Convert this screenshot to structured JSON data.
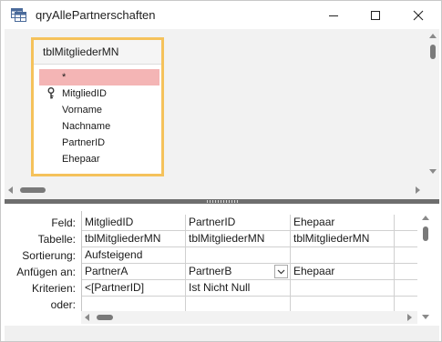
{
  "window": {
    "title": "qryAllePartnerschaften"
  },
  "table": {
    "name": "tblMitgliederMN",
    "fields": [
      "*",
      "MitgliedID",
      "Vorname",
      "Nachname",
      "PartnerID",
      "Ehepaar"
    ],
    "selected_index": 0,
    "key_field_index": 1
  },
  "grid": {
    "row_labels": [
      "Feld:",
      "Tabelle:",
      "Sortierung:",
      "Anfügen an:",
      "Kriterien:",
      "oder:"
    ],
    "columns": [
      {
        "feld": "MitgliedID",
        "tabelle": "tblMitgliederMN",
        "sortierung": "Aufsteigend",
        "anfuegen": "PartnerA",
        "kriterien": "<[PartnerID]",
        "oder": ""
      },
      {
        "feld": "PartnerID",
        "tabelle": "tblMitgliederMN",
        "sortierung": "",
        "anfuegen": "PartnerB",
        "kriterien": "Ist Nicht Null",
        "oder": ""
      },
      {
        "feld": "Ehepaar",
        "tabelle": "tblMitgliederMN",
        "sortierung": "",
        "anfuegen": "Ehepaar",
        "kriterien": "",
        "oder": ""
      },
      {
        "feld": "",
        "tabelle": "",
        "sortierung": "",
        "anfuegen": "",
        "kriterien": "",
        "oder": ""
      }
    ]
  },
  "icons": {
    "app": "query-icon",
    "minimize": "minimize-icon",
    "maximize": "maximize-icon",
    "close": "close-icon",
    "key": "primary-key-icon",
    "dropdown": "chevron-down-icon"
  },
  "colors": {
    "table_border": "#f5c25b",
    "selected_field": "#f4b5b5",
    "design_background": "#f2f2f2"
  }
}
